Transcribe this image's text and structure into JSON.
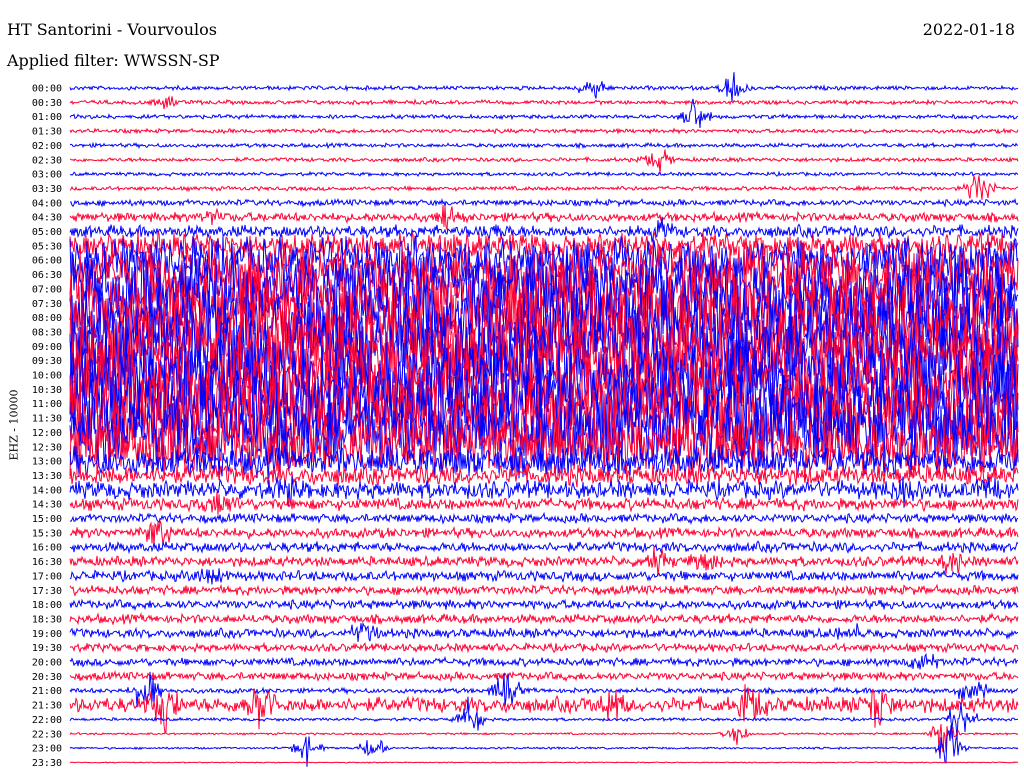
{
  "header": {
    "station": "HT Santorini - Vourvoulos",
    "date": "2022-01-18",
    "filter": "Applied filter: WWSSN-SP"
  },
  "colors": {
    "even_trace": "#0000ff",
    "odd_trace": "#ff0033"
  },
  "chart_data": {
    "type": "line",
    "title": "HT Santorini - Vourvoulos",
    "ylabel": "EHZ - 10000",
    "xlabel": "",
    "rows": [
      {
        "label": "00:00",
        "level": 0.4,
        "events": [
          [
            0.55,
            0.6
          ],
          [
            0.7,
            0.9
          ]
        ]
      },
      {
        "label": "00:30",
        "level": 0.4,
        "events": [
          [
            0.1,
            0.3
          ]
        ]
      },
      {
        "label": "01:00",
        "level": 0.4,
        "events": [
          [
            0.66,
            0.9
          ]
        ]
      },
      {
        "label": "01:30",
        "level": 0.4,
        "events": []
      },
      {
        "label": "02:00",
        "level": 0.4,
        "events": []
      },
      {
        "label": "02:30",
        "level": 0.4,
        "events": [
          [
            0.62,
            0.7
          ]
        ]
      },
      {
        "label": "03:00",
        "level": 0.35,
        "events": []
      },
      {
        "label": "03:30",
        "level": 0.4,
        "events": [
          [
            0.96,
            1.0
          ]
        ]
      },
      {
        "label": "04:00",
        "level": 0.6,
        "events": []
      },
      {
        "label": "04:30",
        "level": 0.9,
        "events": [
          [
            0.15,
            0.5
          ],
          [
            0.4,
            0.6
          ]
        ]
      },
      {
        "label": "05:00",
        "level": 1.2,
        "events": [
          [
            0.45,
            0.4
          ],
          [
            0.62,
            0.8
          ]
        ]
      },
      {
        "label": "05:30",
        "level": 2.5,
        "events": []
      },
      {
        "label": "06:00",
        "level": 4.5,
        "events": []
      },
      {
        "label": "06:30",
        "level": 6.0,
        "events": []
      },
      {
        "label": "07:00",
        "level": 7.0,
        "events": []
      },
      {
        "label": "07:30",
        "level": 7.5,
        "events": []
      },
      {
        "label": "08:00",
        "level": 8.0,
        "events": []
      },
      {
        "label": "08:30",
        "level": 8.0,
        "events": []
      },
      {
        "label": "09:00",
        "level": 8.0,
        "events": []
      },
      {
        "label": "09:30",
        "level": 8.0,
        "events": []
      },
      {
        "label": "10:00",
        "level": 8.0,
        "events": []
      },
      {
        "label": "10:30",
        "level": 8.0,
        "events": []
      },
      {
        "label": "11:00",
        "level": 8.0,
        "events": []
      },
      {
        "label": "11:30",
        "level": 8.0,
        "events": []
      },
      {
        "label": "12:00",
        "level": 7.5,
        "events": []
      },
      {
        "label": "12:30",
        "level": 6.0,
        "events": []
      },
      {
        "label": "13:00",
        "level": 3.0,
        "events": []
      },
      {
        "label": "13:30",
        "level": 2.0,
        "events": []
      },
      {
        "label": "14:00",
        "level": 1.8,
        "events": [
          [
            0.23,
            0.6
          ],
          [
            0.88,
            0.5
          ],
          [
            0.97,
            0.5
          ]
        ]
      },
      {
        "label": "14:30",
        "level": 1.2,
        "events": [
          [
            0.16,
            0.5
          ]
        ]
      },
      {
        "label": "15:00",
        "level": 0.9,
        "events": []
      },
      {
        "label": "15:30",
        "level": 1.0,
        "events": [
          [
            0.09,
            0.8
          ]
        ]
      },
      {
        "label": "16:00",
        "level": 1.0,
        "events": []
      },
      {
        "label": "16:30",
        "level": 1.0,
        "events": [
          [
            0.62,
            0.6
          ],
          [
            0.67,
            0.5
          ],
          [
            0.93,
            0.7
          ]
        ]
      },
      {
        "label": "17:00",
        "level": 1.0,
        "events": [
          [
            0.15,
            0.5
          ]
        ]
      },
      {
        "label": "17:30",
        "level": 0.9,
        "events": []
      },
      {
        "label": "18:00",
        "level": 0.9,
        "events": []
      },
      {
        "label": "18:30",
        "level": 0.9,
        "events": []
      },
      {
        "label": "19:00",
        "level": 0.9,
        "events": [
          [
            0.31,
            0.7
          ],
          [
            0.82,
            0.5
          ]
        ]
      },
      {
        "label": "19:30",
        "level": 0.8,
        "events": []
      },
      {
        "label": "20:00",
        "level": 0.8,
        "events": [
          [
            0.9,
            0.5
          ]
        ]
      },
      {
        "label": "20:30",
        "level": 0.8,
        "events": []
      },
      {
        "label": "21:00",
        "level": 0.5,
        "events": [
          [
            0.08,
            1.3
          ],
          [
            0.46,
            1.0
          ],
          [
            0.95,
            1.1
          ]
        ]
      },
      {
        "label": "21:30",
        "level": 1.5,
        "events": [
          [
            0.1,
            1.4
          ],
          [
            0.2,
            1.2
          ],
          [
            0.57,
            1.1
          ],
          [
            0.72,
            1.0
          ],
          [
            0.85,
            1.3
          ]
        ]
      },
      {
        "label": "22:00",
        "level": 0.3,
        "events": [
          [
            0.42,
            1.0
          ],
          [
            0.94,
            1.3
          ]
        ]
      },
      {
        "label": "22:30",
        "level": 0.2,
        "events": [
          [
            0.7,
            0.7
          ],
          [
            0.92,
            1.0
          ]
        ]
      },
      {
        "label": "23:00",
        "level": 0.2,
        "events": [
          [
            0.25,
            1.0
          ],
          [
            0.32,
            0.6
          ],
          [
            0.93,
            1.3
          ]
        ]
      },
      {
        "label": "23:30",
        "level": 0.1,
        "events": []
      }
    ]
  }
}
